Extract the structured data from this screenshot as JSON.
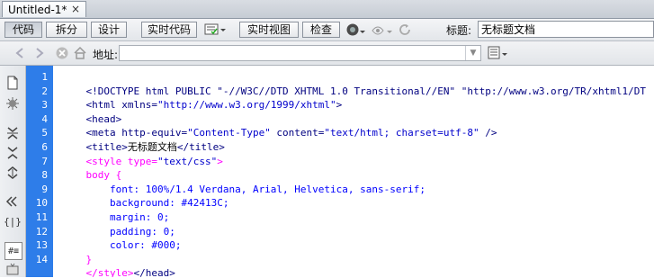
{
  "tab": {
    "title": "Untitled-1*",
    "close": "×"
  },
  "toolbar": {
    "code": "代码",
    "split": "拆分",
    "design": "设计",
    "live_code": "实时代码",
    "live_view": "实时视图",
    "inspect": "检查",
    "title_label": "标题:",
    "title_value": "无标题文档"
  },
  "address": {
    "label": "地址:",
    "value": ""
  },
  "line_numbers": [
    "1",
    "2",
    "3",
    "4",
    "5",
    "6",
    "7",
    "8",
    "9",
    "10",
    "11",
    "12",
    "13",
    "14"
  ],
  "code_lines": [
    {
      "parts": [
        {
          "t": "<!DOCTYPE html PUBLIC \"-//W3C//DTD XHTML 1.0 Transitional//EN\" \"http://www.w3.org/TR/xhtml1/DT",
          "c": "tag"
        }
      ]
    },
    {
      "parts": [
        {
          "t": "<html xmlns=",
          "c": "tag"
        },
        {
          "t": "\"http://www.w3.org/1999/xhtml\"",
          "c": "val"
        },
        {
          "t": ">",
          "c": "tag"
        }
      ]
    },
    {
      "parts": [
        {
          "t": "<head>",
          "c": "tag"
        }
      ]
    },
    {
      "parts": [
        {
          "t": "<meta http-equiv=",
          "c": "tag"
        },
        {
          "t": "\"Content-Type\"",
          "c": "val"
        },
        {
          "t": " content=",
          "c": "tag"
        },
        {
          "t": "\"text/html; charset=utf-8\"",
          "c": "val"
        },
        {
          "t": " />",
          "c": "tag"
        }
      ]
    },
    {
      "parts": [
        {
          "t": "<title>",
          "c": "tag"
        },
        {
          "t": "无标题文档",
          "c": "txt"
        },
        {
          "t": "</title>",
          "c": "tag"
        }
      ]
    },
    {
      "parts": [
        {
          "t": "<style type=",
          "c": "sel"
        },
        {
          "t": "\"text/css\"",
          "c": "val"
        },
        {
          "t": ">",
          "c": "sel"
        }
      ]
    },
    {
      "parts": [
        {
          "t": "body {",
          "c": "sel"
        }
      ]
    },
    {
      "parts": [
        {
          "t": "    font: ",
          "c": "prop"
        },
        {
          "t": "100%/1.4 Verdana, Arial, Helvetica, sans-serif;",
          "c": "css-val"
        }
      ]
    },
    {
      "parts": [
        {
          "t": "    background: ",
          "c": "prop"
        },
        {
          "t": "#42413C;",
          "c": "css-val"
        }
      ]
    },
    {
      "parts": [
        {
          "t": "    margin: ",
          "c": "prop"
        },
        {
          "t": "0;",
          "c": "css-val"
        }
      ]
    },
    {
      "parts": [
        {
          "t": "    padding: ",
          "c": "prop"
        },
        {
          "t": "0;",
          "c": "css-val"
        }
      ]
    },
    {
      "parts": [
        {
          "t": "    color: ",
          "c": "prop"
        },
        {
          "t": "#000;",
          "c": "css-val"
        }
      ]
    },
    {
      "parts": [
        {
          "t": "}",
          "c": "sel"
        }
      ]
    },
    {
      "parts": [
        {
          "t": "</style>",
          "c": "sel"
        },
        {
          "t": "</head>",
          "c": "tag"
        }
      ]
    }
  ]
}
